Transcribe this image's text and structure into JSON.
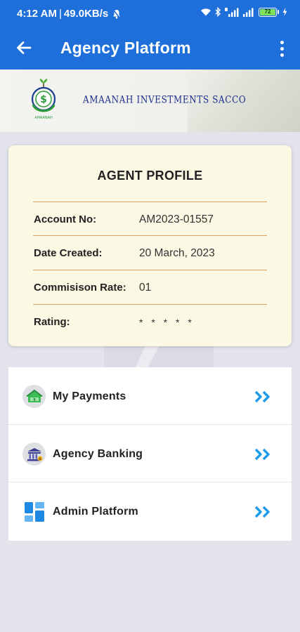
{
  "status_bar": {
    "time": "4:12 AM",
    "separator": "|",
    "speed": "49.0KB/s",
    "battery": "72"
  },
  "app_bar": {
    "title": "Agency Platform"
  },
  "banner": {
    "brand_name": "AMAANAH INVESTMENTS SACCO",
    "logo_caption": "AMAANAH"
  },
  "profile": {
    "title": "AGENT PROFILE",
    "rows": [
      {
        "label": "Account No:",
        "value": "AM2023-01557"
      },
      {
        "label": "Date Created:",
        "value": "20 March, 2023"
      },
      {
        "label": "Commisison Rate:",
        "value": "01"
      },
      {
        "label": "Rating:",
        "value": "* * * * *"
      }
    ]
  },
  "menu": {
    "items": [
      {
        "label": "My Payments",
        "icon": "payments-house-icon"
      },
      {
        "label": "Agency Banking",
        "icon": "bank-icon"
      },
      {
        "label": "Admin Platform",
        "icon": "dashboard-icon"
      }
    ]
  },
  "colors": {
    "primary": "#1e6fd9",
    "card_bg": "#fbf8e4",
    "row_divider": "#e2a462",
    "chevron": "#1e9be8",
    "page_bg": "#e3e3ec"
  }
}
